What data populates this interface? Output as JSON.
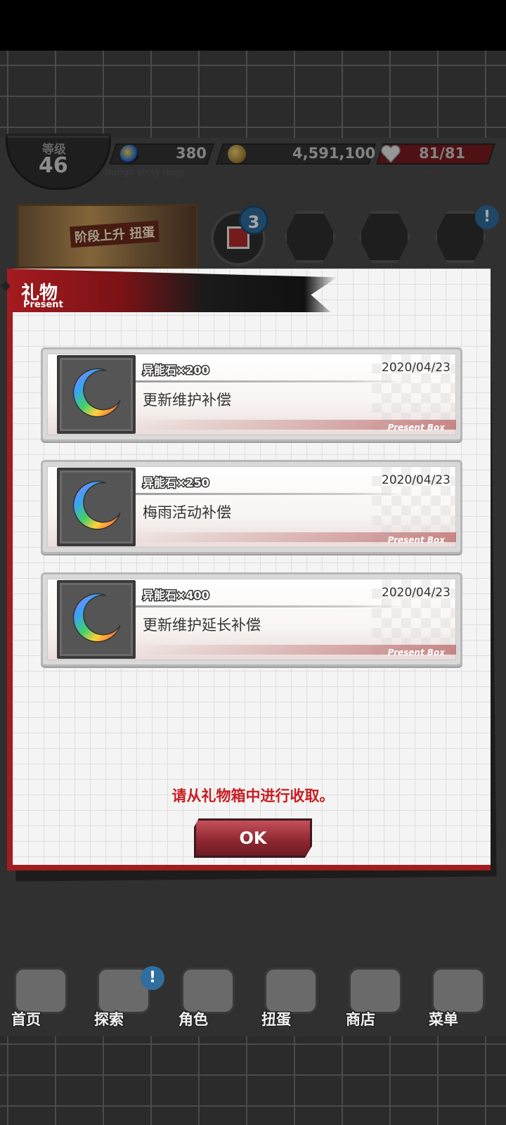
{
  "hud": {
    "level_label": "等级",
    "level_value": "46",
    "stones": "380",
    "coins": "4,591,100",
    "stamina": "81/81",
    "subtitle": "bungo stray dogs",
    "stamina_timer": "--:--"
  },
  "top_buttons": {
    "banner_text": "阶段上升 扭蛋",
    "gift_badge": "3",
    "alert_badge": "!"
  },
  "dialog": {
    "title": "礼物",
    "subtitle": "Present",
    "notice": "请从礼物箱中进行收取。",
    "ok_label": "OK",
    "items": [
      {
        "quantity": "异能石×200",
        "date": "2020/04/23",
        "name": "更新维护补偿",
        "tag": "Present Box"
      },
      {
        "quantity": "异能石×250",
        "date": "2020/04/23",
        "name": "梅雨活动补偿",
        "tag": "Present Box"
      },
      {
        "quantity": "异能石×400",
        "date": "2020/04/23",
        "name": "更新维护延长补偿",
        "tag": "Present Box"
      }
    ]
  },
  "nav": {
    "items": [
      {
        "label": "首页",
        "icon": "bungou-home-icon"
      },
      {
        "label": "探索",
        "icon": "explore-icon"
      },
      {
        "label": "角色",
        "icon": "characters-icon"
      },
      {
        "label": "扭蛋",
        "icon": "gacha-book-icon"
      },
      {
        "label": "商店",
        "icon": "shop-moon-icon"
      },
      {
        "label": "菜单",
        "icon": "gear-menu-icon"
      }
    ],
    "badge": "!"
  },
  "colors": {
    "accent_red": "#a11c1f",
    "notice_red": "#c81e22",
    "badge_blue": "#2f6e9e"
  }
}
